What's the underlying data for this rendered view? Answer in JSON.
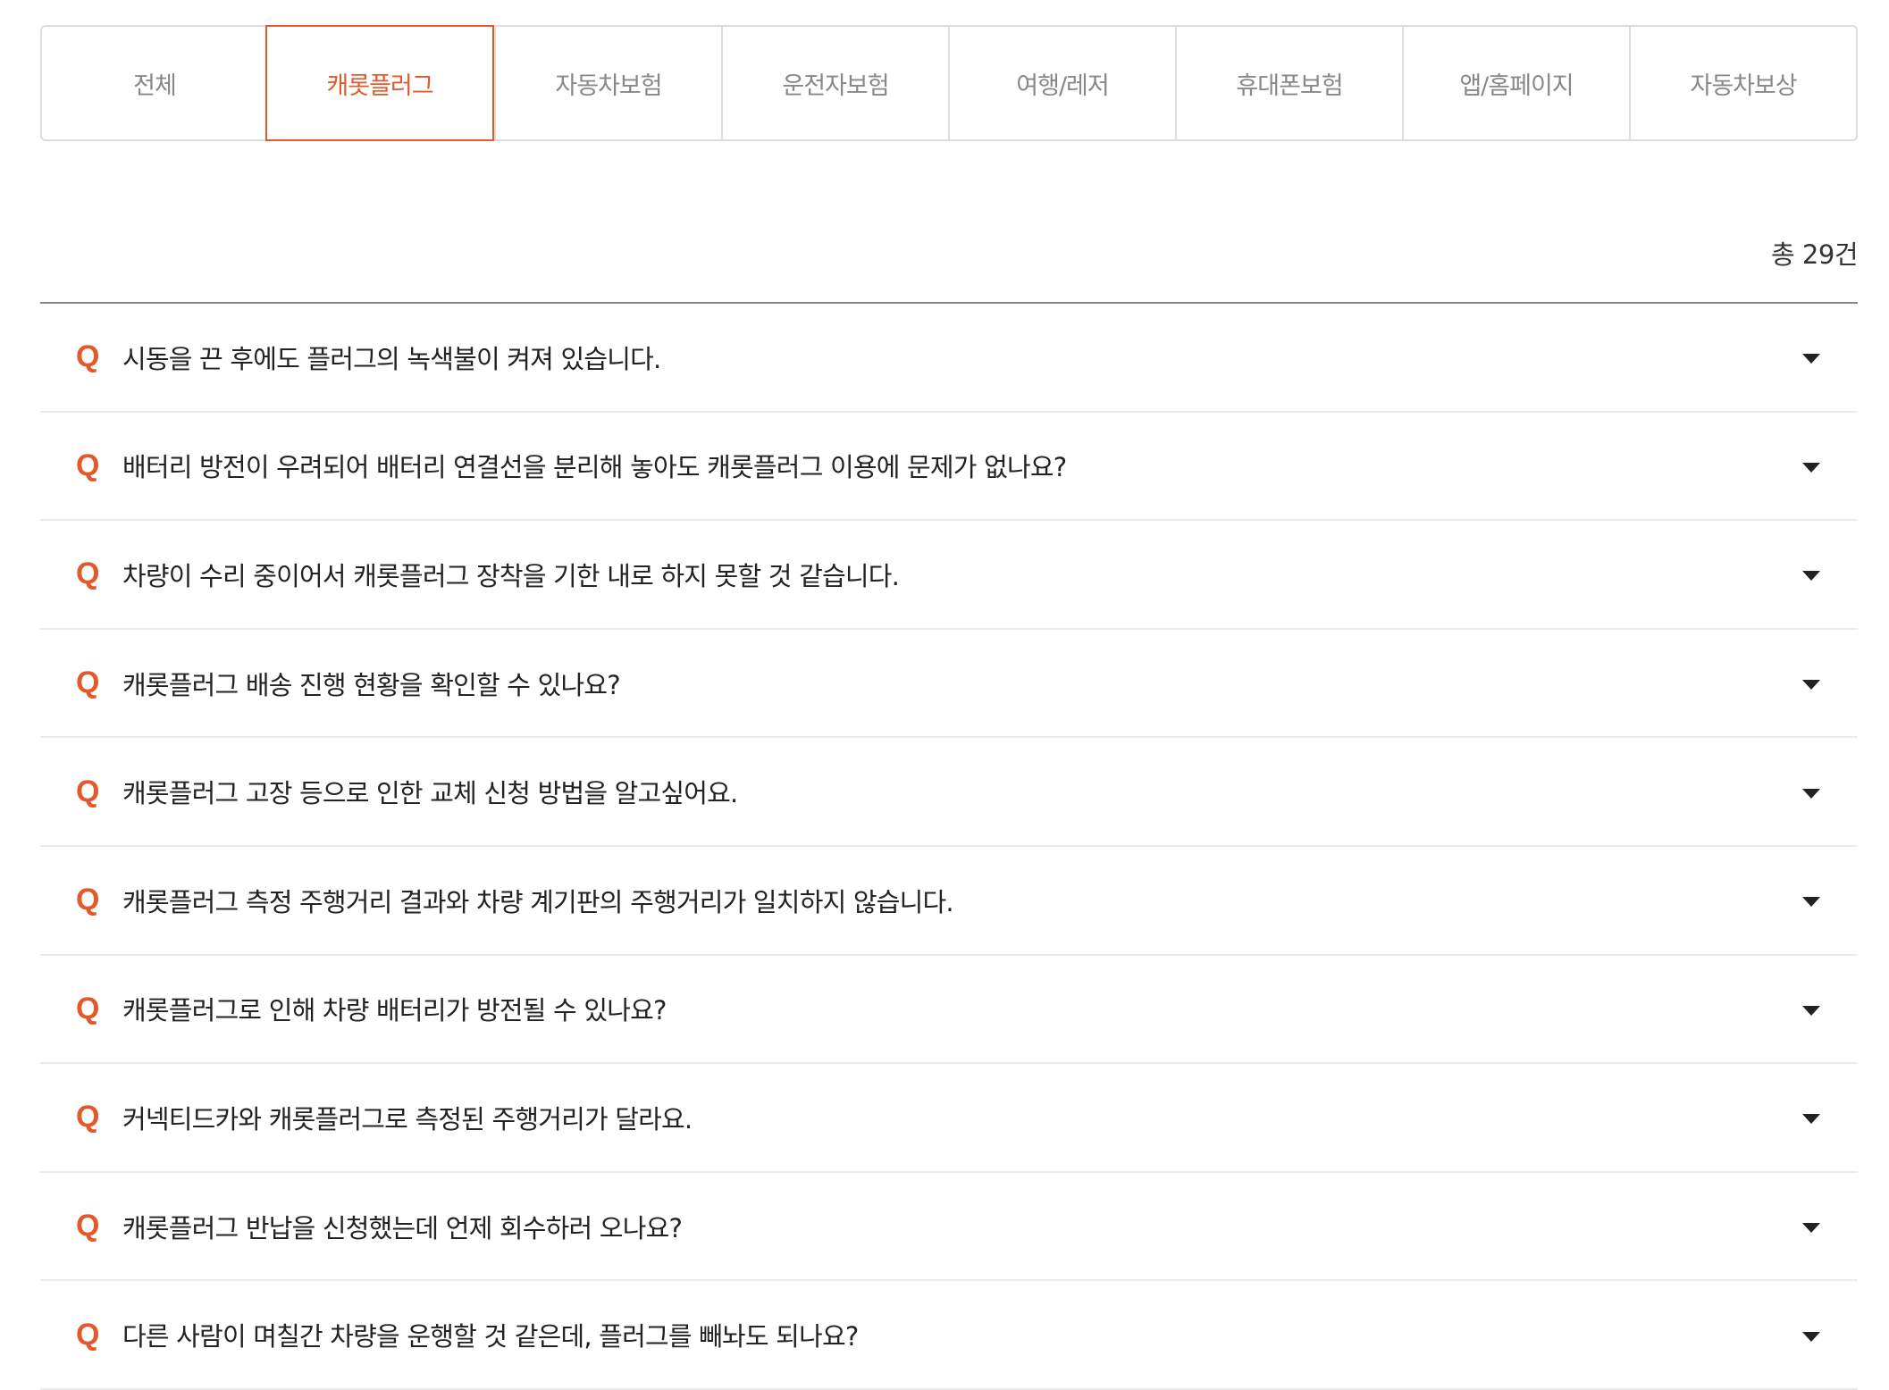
{
  "tabs": [
    {
      "label": "전체",
      "active": false
    },
    {
      "label": "캐롯플러그",
      "active": true
    },
    {
      "label": "자동차보험",
      "active": false
    },
    {
      "label": "운전자보험",
      "active": false
    },
    {
      "label": "여행/레저",
      "active": false
    },
    {
      "label": "휴대폰보험",
      "active": false
    },
    {
      "label": "앱/홈페이지",
      "active": false
    },
    {
      "label": "자동차보상",
      "active": false
    }
  ],
  "count_text": "총 29건",
  "faq": {
    "q_label": "Q",
    "items": [
      "시동을 끈 후에도 플러그의 녹색불이 켜져 있습니다.",
      "배터리 방전이 우려되어 배터리 연결선을 분리해 놓아도 캐롯플러그 이용에 문제가 없나요?",
      "차량이 수리 중이어서 캐롯플러그 장착을 기한 내로 하지 못할 것 같습니다.",
      "캐롯플러그 배송 진행 현황을 확인할 수 있나요?",
      "캐롯플러그 고장 등으로 인한 교체 신청 방법을 알고싶어요.",
      "캐롯플러그 측정 주행거리 결과와 차량 계기판의 주행거리가 일치하지 않습니다.",
      "캐롯플러그로 인해 차량 배터리가 방전될 수 있나요?",
      "커넥티드카와 캐롯플러그로 측정된 주행거리가 달라요.",
      "캐롯플러그 반납을 신청했는데 언제 회수하러 오나요?",
      "다른 사람이 며칠간 차량을 운행할 것 같은데, 플러그를 빼놔도 되나요?"
    ]
  },
  "colors": {
    "accent": "#e4592b",
    "tab_inactive_text": "#888888",
    "border": "#dddddd"
  },
  "icons": {
    "expand": "chevron-down-icon"
  }
}
